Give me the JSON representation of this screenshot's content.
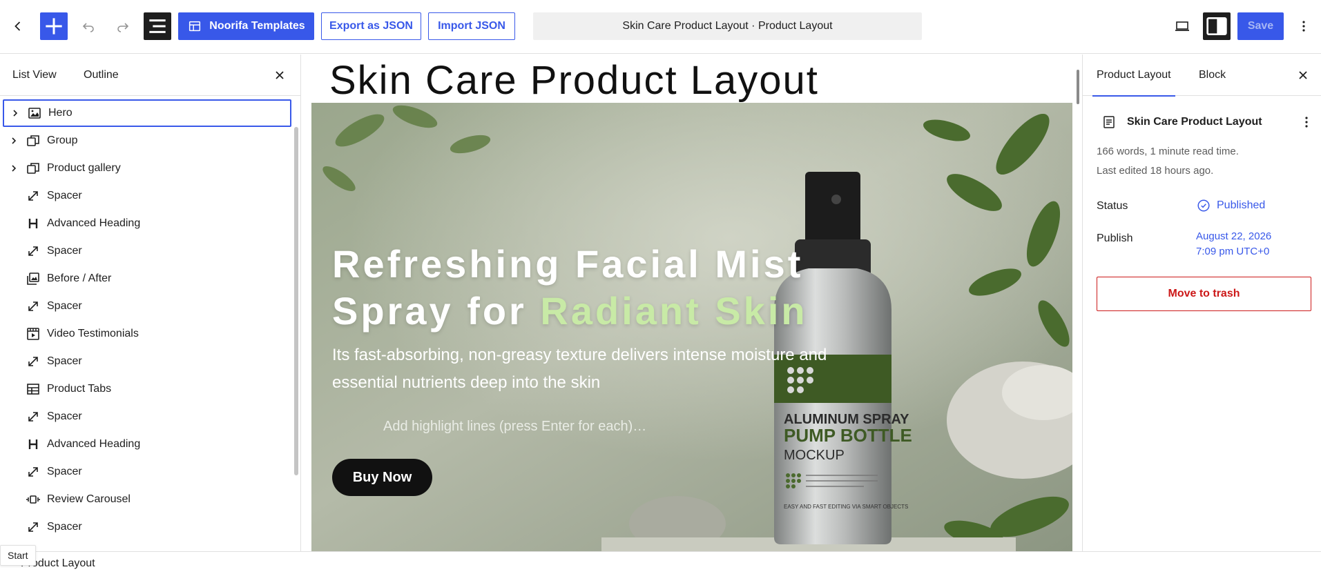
{
  "toolbar": {
    "templates_label": "Noorifa Templates",
    "export_label": "Export as JSON",
    "import_label": "Import JSON",
    "document_title": "Skin Care Product Layout · Product Layout",
    "save_label": "Save"
  },
  "left_panel": {
    "tabs": [
      "List View",
      "Outline"
    ],
    "items": [
      {
        "label": "Hero",
        "icon": "hero-block-icon",
        "expandable": true,
        "selected": true
      },
      {
        "label": "Group",
        "icon": "group-block-icon",
        "expandable": true
      },
      {
        "label": "Product gallery",
        "icon": "group-block-icon",
        "expandable": true
      },
      {
        "label": "Spacer",
        "icon": "spacer-block-icon"
      },
      {
        "label": "Advanced Heading",
        "icon": "heading-block-icon"
      },
      {
        "label": "Spacer",
        "icon": "spacer-block-icon"
      },
      {
        "label": "Before / After",
        "icon": "gallery-block-icon"
      },
      {
        "label": "Spacer",
        "icon": "spacer-block-icon"
      },
      {
        "label": "Video Testimonials",
        "icon": "video-block-icon"
      },
      {
        "label": "Spacer",
        "icon": "spacer-block-icon"
      },
      {
        "label": "Product Tabs",
        "icon": "table-block-icon"
      },
      {
        "label": "Spacer",
        "icon": "spacer-block-icon"
      },
      {
        "label": "Advanced Heading",
        "icon": "heading-block-icon"
      },
      {
        "label": "Spacer",
        "icon": "spacer-block-icon"
      },
      {
        "label": "Review Carousel",
        "icon": "carousel-block-icon"
      },
      {
        "label": "Spacer",
        "icon": "spacer-block-icon"
      }
    ]
  },
  "canvas": {
    "page_title": "Skin Care Product Layout",
    "hero": {
      "heading_line1": "Refreshing Facial Mist",
      "heading_line2_prefix": "Spray for ",
      "heading_line2_accent": "Radiant Skin",
      "paragraph": "Its fast-absorbing, non-greasy texture delivers intense moisture and essential nutrients deep into the skin",
      "highlight_placeholder": "Add highlight lines (press Enter for each)…",
      "button_label": "Buy Now",
      "bottle_text_line1": "ALUMINUM SPRAY",
      "bottle_text_line2": "PUMP BOTTLE",
      "bottle_text_line3": "MOCKUP",
      "bottle_text_small": "EASY AND FAST EDITING VIA SMART OBJECTS"
    }
  },
  "right_panel": {
    "tabs": [
      "Product Layout",
      "Block"
    ],
    "document_name": "Skin Care Product Layout",
    "stats": "166 words, 1 minute read time.",
    "last_edited": "Last edited 18 hours ago.",
    "status_label": "Status",
    "status_value": "Published",
    "publish_label": "Publish",
    "publish_date": "August 22, 2026",
    "publish_time": "7:09 pm UTC+0",
    "trash_label": "Move to trash"
  },
  "footer": {
    "breadcrumb": "Product Layout",
    "tooltip": "Start"
  },
  "colors": {
    "accent": "#3858e9",
    "danger": "#cc1818",
    "hero_accent_text": "#c8eaa6"
  }
}
